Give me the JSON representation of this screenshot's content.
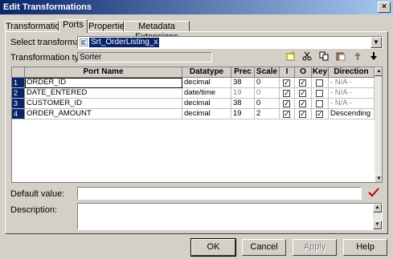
{
  "window": {
    "title": "Edit Transformations",
    "close": "×"
  },
  "tabs": [
    {
      "label": "Transformation"
    },
    {
      "label": "Ports"
    },
    {
      "label": "Properties"
    },
    {
      "label": "Metadata Extensions"
    }
  ],
  "select_transformation": {
    "label": "Select transformation:",
    "value": "Srt_OrderListing_x"
  },
  "transformation_type": {
    "label": "Transformation type:",
    "value": "Sorter"
  },
  "toolbar": {
    "new_icon": "new-port-icon",
    "cut_icon": "cut-icon",
    "copy_icon": "copy-icon",
    "paste_icon": "paste-icon",
    "up_icon": "move-up-icon",
    "down_icon": "move-down-icon"
  },
  "grid": {
    "headers": [
      "Port Name",
      "Datatype",
      "Prec",
      "Scale",
      "I",
      "O",
      "Key",
      "Direction"
    ],
    "rows": [
      {
        "num": "1",
        "name": "ORDER_ID",
        "datatype": "decimal",
        "prec": "38",
        "scale": "0",
        "i": true,
        "o": true,
        "key": false,
        "direction": "- N/A -",
        "grey": false
      },
      {
        "num": "2",
        "name": "DATE_ENTERED",
        "datatype": "date/time",
        "prec": "19",
        "scale": "0",
        "i": true,
        "o": true,
        "key": false,
        "direction": "- N/A -",
        "grey": true
      },
      {
        "num": "3",
        "name": "CUSTOMER_ID",
        "datatype": "decimal",
        "prec": "38",
        "scale": "0",
        "i": true,
        "o": true,
        "key": false,
        "direction": "- N/A -",
        "grey": false
      },
      {
        "num": "4",
        "name": "ORDER_AMOUNT",
        "datatype": "decimal",
        "prec": "19",
        "scale": "2",
        "i": true,
        "o": true,
        "key": true,
        "direction": "Descending",
        "grey": false
      }
    ]
  },
  "default_value": {
    "label": "Default value:",
    "value": ""
  },
  "description": {
    "label": "Description:",
    "value": ""
  },
  "buttons": {
    "ok": "OK",
    "cancel": "Cancel",
    "apply": "Apply",
    "help": "Help"
  },
  "colors": {
    "title_start": "#0a246a",
    "title_end": "#a6caf0",
    "selection": "#0a246a",
    "checkmark_red": "#c00000"
  }
}
